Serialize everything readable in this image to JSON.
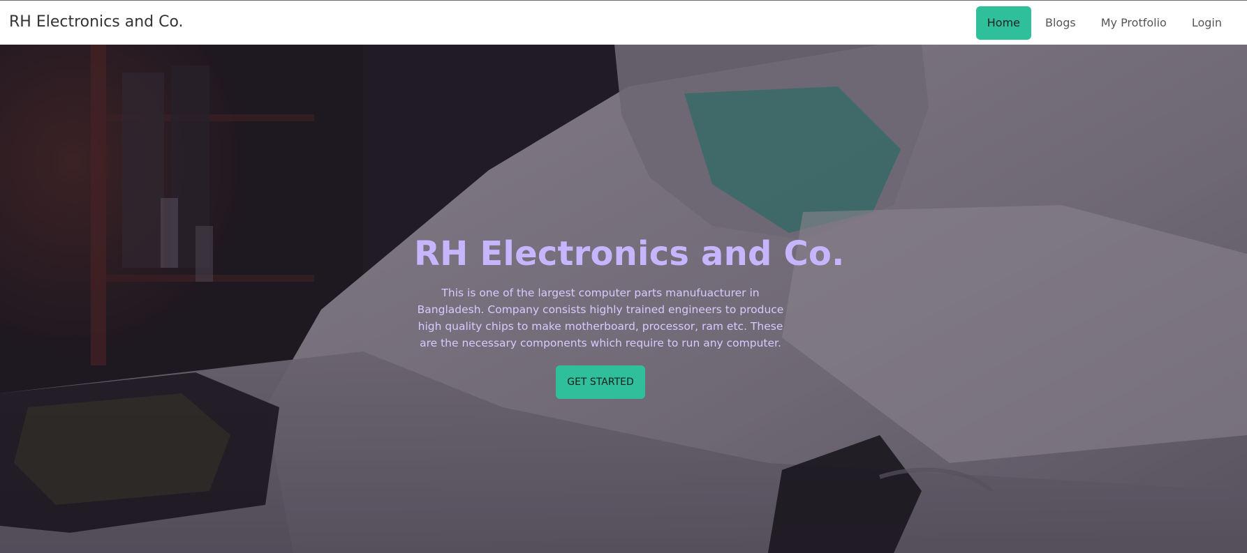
{
  "brand": "RH Electronics and Co.",
  "nav": [
    {
      "label": "Home",
      "active": true
    },
    {
      "label": "Blogs",
      "active": false
    },
    {
      "label": "My Protfolio",
      "active": false
    },
    {
      "label": "Login",
      "active": false
    }
  ],
  "hero": {
    "title": "RH Electronics and Co.",
    "description": "This is one of the largest computer parts manufuacturer in Bangladesh. Company consists highly trained engineers to produce high quality chips to make motherboard, processor, ram etc. These are the necessary components which require to run any computer.",
    "cta_label": "GET STARTED"
  },
  "colors": {
    "accent": "#2fbf9b",
    "hero_text": "#c7b6ff",
    "navbar_bg": "#ffffff"
  }
}
